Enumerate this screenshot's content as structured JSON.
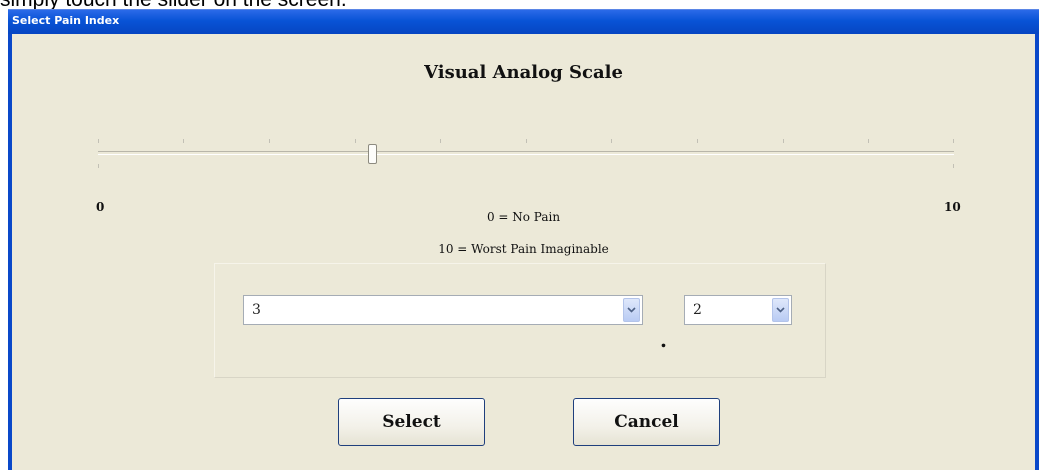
{
  "caption": "simply touch the slider on the screen.",
  "window": {
    "title": "Select Pain Index"
  },
  "scale": {
    "heading": "Visual Analog Scale",
    "min_label": "0",
    "max_label": "10",
    "legend_min": "0 = No Pain",
    "legend_max": "10 = Worst Pain Imaginable",
    "slider_value": 3.2,
    "slider_min": 0,
    "slider_max": 10
  },
  "selection": {
    "whole_value": "3",
    "separator": ".",
    "decimal_value": "2"
  },
  "buttons": {
    "select_label": "Select",
    "cancel_label": "Cancel"
  },
  "colors": {
    "titlebar": "#0853d6",
    "client_background": "#ece9d8",
    "button_border": "#1f3f7d"
  }
}
